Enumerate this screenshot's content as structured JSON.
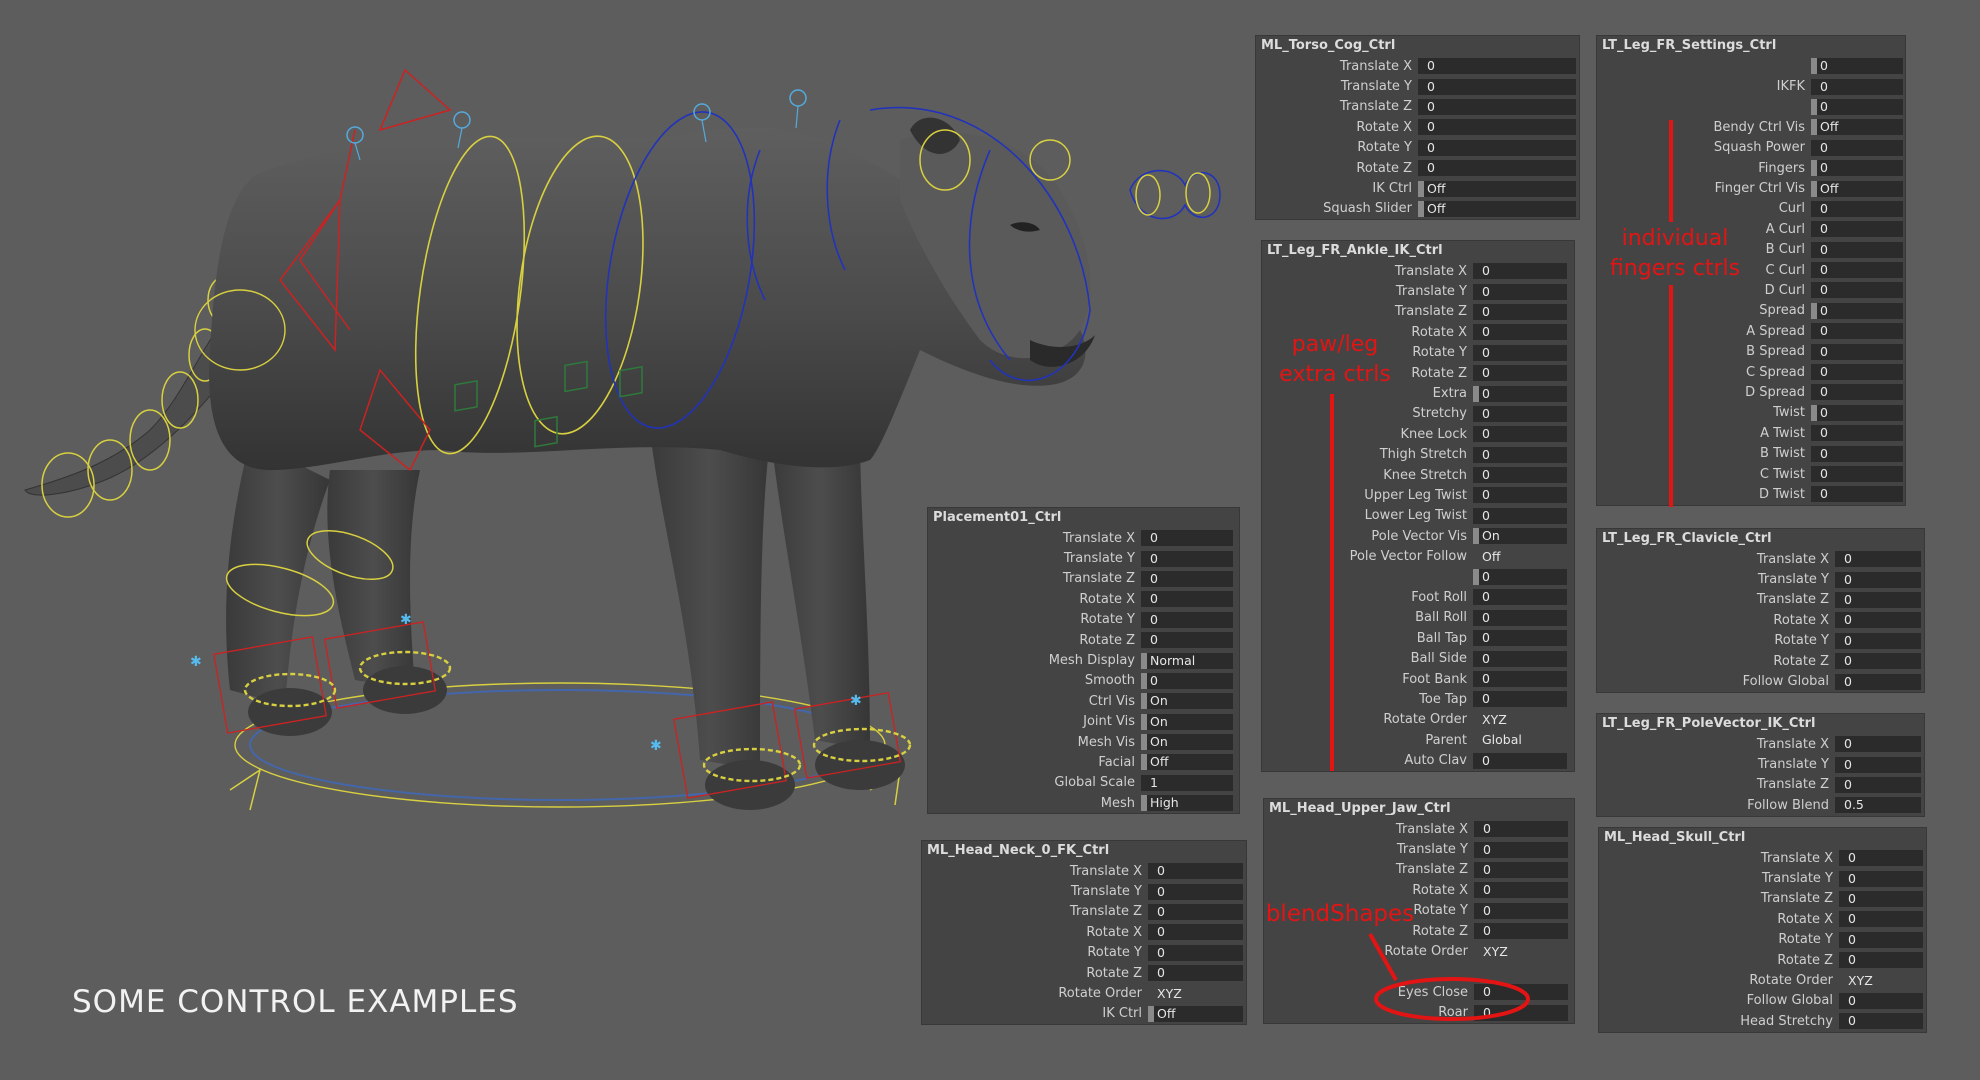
{
  "caption": "SOME CONTROL EXAMPLES",
  "annotations": {
    "paw_leg": [
      "paw/leg",
      "extra ctrls"
    ],
    "fingers": [
      "individual",
      "fingers ctrls"
    ],
    "blend": "blendShapes"
  },
  "panels": {
    "torso_cog": {
      "title": "ML_Torso_Cog_Ctrl",
      "rows": [
        {
          "label": "Translate X",
          "value": "0"
        },
        {
          "label": "Translate Y",
          "value": "0"
        },
        {
          "label": "Translate Z",
          "value": "0"
        },
        {
          "label": "Rotate X",
          "value": "0"
        },
        {
          "label": "Rotate Y",
          "value": "0"
        },
        {
          "label": "Rotate Z",
          "value": "0"
        },
        {
          "label": "IK Ctrl",
          "value": "Off",
          "marker": true
        },
        {
          "label": "Squash Slider",
          "value": "Off",
          "marker": true
        }
      ]
    },
    "leg_settings": {
      "title": "LT_Leg_FR_Settings_Ctrl",
      "rows": [
        {
          "label": "",
          "value": "0",
          "marker": true
        },
        {
          "label": "IKFK",
          "value": "0"
        },
        {
          "label": "",
          "value": "0",
          "marker": true
        },
        {
          "label": "Bendy Ctrl Vis",
          "value": "Off",
          "marker": true
        },
        {
          "label": "Squash Power",
          "value": "0"
        },
        {
          "label": "Fingers",
          "value": "0",
          "marker": true
        },
        {
          "label": "Finger Ctrl Vis",
          "value": "Off",
          "marker": true
        },
        {
          "label": "Curl",
          "value": "0"
        },
        {
          "label": "A Curl",
          "value": "0"
        },
        {
          "label": "B Curl",
          "value": "0"
        },
        {
          "label": "C Curl",
          "value": "0"
        },
        {
          "label": "D Curl",
          "value": "0"
        },
        {
          "label": "Spread",
          "value": "0",
          "marker": true
        },
        {
          "label": "A Spread",
          "value": "0"
        },
        {
          "label": "B Spread",
          "value": "0"
        },
        {
          "label": "C Spread",
          "value": "0"
        },
        {
          "label": "D Spread",
          "value": "0"
        },
        {
          "label": "Twist",
          "value": "0",
          "marker": true
        },
        {
          "label": "A Twist",
          "value": "0"
        },
        {
          "label": "B Twist",
          "value": "0"
        },
        {
          "label": "C Twist",
          "value": "0"
        },
        {
          "label": "D Twist",
          "value": "0"
        }
      ]
    },
    "ankle_ik": {
      "title": "LT_Leg_FR_Ankle_IK_Ctrl",
      "rows": [
        {
          "label": "Translate X",
          "value": "0"
        },
        {
          "label": "Translate Y",
          "value": "0"
        },
        {
          "label": "Translate Z",
          "value": "0"
        },
        {
          "label": "Rotate X",
          "value": "0"
        },
        {
          "label": "Rotate Y",
          "value": "0"
        },
        {
          "label": "Rotate Z",
          "value": "0"
        },
        {
          "label": "Extra",
          "value": "0",
          "marker": true
        },
        {
          "label": "Stretchy",
          "value": "0"
        },
        {
          "label": "Knee Lock",
          "value": "0"
        },
        {
          "label": "Thigh Stretch",
          "value": "0"
        },
        {
          "label": "Knee Stretch",
          "value": "0"
        },
        {
          "label": "Upper Leg Twist",
          "value": "0"
        },
        {
          "label": "Lower Leg Twist",
          "value": "0"
        },
        {
          "label": "Pole Vector Vis",
          "value": "On",
          "marker": true
        },
        {
          "label": "Pole Vector Follow",
          "value": "Off",
          "enum": true
        },
        {
          "label": "",
          "value": "0",
          "marker": true
        },
        {
          "label": "Foot Roll",
          "value": "0"
        },
        {
          "label": "Ball Roll",
          "value": "0"
        },
        {
          "label": "Ball Tap",
          "value": "0"
        },
        {
          "label": "Ball Side",
          "value": "0"
        },
        {
          "label": "Foot Bank",
          "value": "0"
        },
        {
          "label": "Toe Tap",
          "value": "0"
        },
        {
          "label": "Rotate Order",
          "value": "XYZ",
          "enum": true
        },
        {
          "label": "Parent",
          "value": "Global",
          "enum": true
        },
        {
          "label": "Auto Clav",
          "value": "0"
        }
      ]
    },
    "placement": {
      "title": "Placement01_Ctrl",
      "rows": [
        {
          "label": "Translate X",
          "value": "0"
        },
        {
          "label": "Translate Y",
          "value": "0"
        },
        {
          "label": "Translate Z",
          "value": "0"
        },
        {
          "label": "Rotate X",
          "value": "0"
        },
        {
          "label": "Rotate Y",
          "value": "0"
        },
        {
          "label": "Rotate Z",
          "value": "0"
        },
        {
          "label": "Mesh Display",
          "value": "Normal",
          "marker": true
        },
        {
          "label": "Smooth",
          "value": "0",
          "marker": true
        },
        {
          "label": "Ctrl Vis",
          "value": "On",
          "marker": true
        },
        {
          "label": "Joint Vis",
          "value": "On",
          "marker": true
        },
        {
          "label": "Mesh Vis",
          "value": "On",
          "marker": true
        },
        {
          "label": "Facial",
          "value": "Off",
          "marker": true
        },
        {
          "label": "Global Scale",
          "value": "1"
        },
        {
          "label": "Mesh",
          "value": "High",
          "marker": true
        }
      ]
    },
    "clavicle": {
      "title": "LT_Leg_FR_Clavicle_Ctrl",
      "rows": [
        {
          "label": "Translate X",
          "value": "0"
        },
        {
          "label": "Translate Y",
          "value": "0"
        },
        {
          "label": "Translate Z",
          "value": "0"
        },
        {
          "label": "Rotate X",
          "value": "0"
        },
        {
          "label": "Rotate Y",
          "value": "0"
        },
        {
          "label": "Rotate Z",
          "value": "0"
        },
        {
          "label": "Follow Global",
          "value": "0"
        }
      ]
    },
    "pole_vector": {
      "title": "LT_Leg_FR_PoleVector_IK_Ctrl",
      "rows": [
        {
          "label": "Translate X",
          "value": "0"
        },
        {
          "label": "Translate Y",
          "value": "0"
        },
        {
          "label": "Translate Z",
          "value": "0"
        },
        {
          "label": "Follow Blend",
          "value": "0.5"
        }
      ]
    },
    "head_upper_jaw": {
      "title": "ML_Head_Upper_Jaw_Ctrl",
      "rows": [
        {
          "label": "Translate X",
          "value": "0"
        },
        {
          "label": "Translate Y",
          "value": "0"
        },
        {
          "label": "Translate Z",
          "value": "0"
        },
        {
          "label": "Rotate X",
          "value": "0"
        },
        {
          "label": "Rotate Y",
          "value": "0"
        },
        {
          "label": "Rotate Z",
          "value": "0"
        },
        {
          "label": "Rotate Order",
          "value": "XYZ",
          "enum": true
        },
        {
          "label": "",
          "value": "",
          "blank": true
        },
        {
          "label": "Eyes Close",
          "value": "0"
        },
        {
          "label": "Roar",
          "value": "0"
        }
      ]
    },
    "head_neck": {
      "title": "ML_Head_Neck_0_FK_Ctrl",
      "rows": [
        {
          "label": "Translate X",
          "value": "0"
        },
        {
          "label": "Translate Y",
          "value": "0"
        },
        {
          "label": "Translate Z",
          "value": "0"
        },
        {
          "label": "Rotate X",
          "value": "0"
        },
        {
          "label": "Rotate Y",
          "value": "0"
        },
        {
          "label": "Rotate Z",
          "value": "0"
        },
        {
          "label": "Rotate Order",
          "value": "XYZ",
          "enum": true
        },
        {
          "label": "IK Ctrl",
          "value": "Off",
          "marker": true
        }
      ]
    },
    "head_skull": {
      "title": "ML_Head_Skull_Ctrl",
      "rows": [
        {
          "label": "Translate X",
          "value": "0"
        },
        {
          "label": "Translate Y",
          "value": "0"
        },
        {
          "label": "Translate Z",
          "value": "0"
        },
        {
          "label": "Rotate X",
          "value": "0"
        },
        {
          "label": "Rotate Y",
          "value": "0"
        },
        {
          "label": "Rotate Z",
          "value": "0"
        },
        {
          "label": "Rotate Order",
          "value": "XYZ",
          "enum": true
        },
        {
          "label": "Follow Global",
          "value": "0"
        },
        {
          "label": "Head Stretchy",
          "value": "0"
        }
      ]
    }
  }
}
